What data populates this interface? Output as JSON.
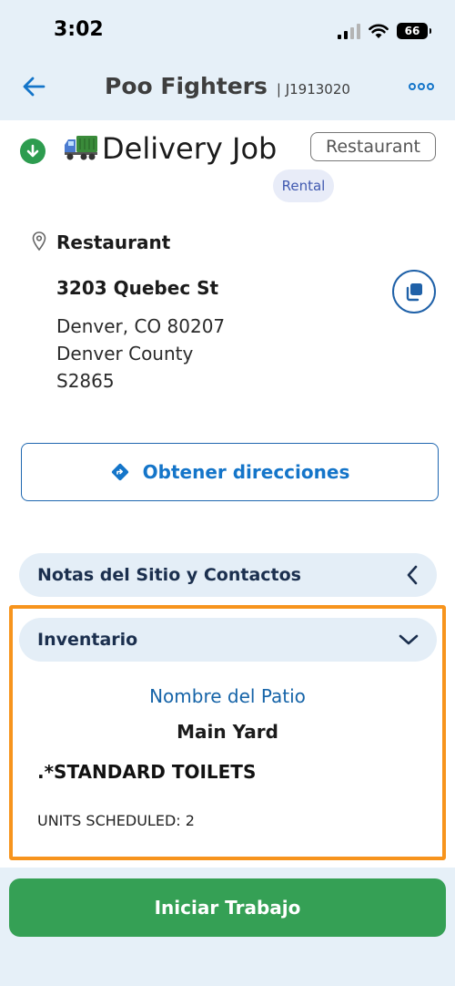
{
  "status_bar": {
    "time": "3:02",
    "battery": "66"
  },
  "nav": {
    "title": "Poo Fighters",
    "job_id": "| J1913020"
  },
  "job": {
    "title": "Delivery Job",
    "type_badge": "Restaurant",
    "tag": "Rental"
  },
  "location": {
    "name": "Restaurant",
    "street": "3203 Quebec St",
    "city_line": "Denver, CO 80207",
    "county": "Denver County",
    "code": "S2865"
  },
  "directions_label": "Obtener direcciones",
  "sections": {
    "site_notes": "Notas del Sitio y Contactos",
    "inventory": "Inventario"
  },
  "inventory": {
    "yard_label": "Nombre del Patio",
    "yard_value": "Main Yard",
    "item_name": ".*STANDARD TOILETS",
    "units": "UNITS SCHEDULED: 2"
  },
  "start_button": "Iniciar Trabajo",
  "colors": {
    "accent": "#1475c9",
    "green": "#35a055",
    "highlight": "#f7941d",
    "header_bg": "#e6f0f8"
  }
}
